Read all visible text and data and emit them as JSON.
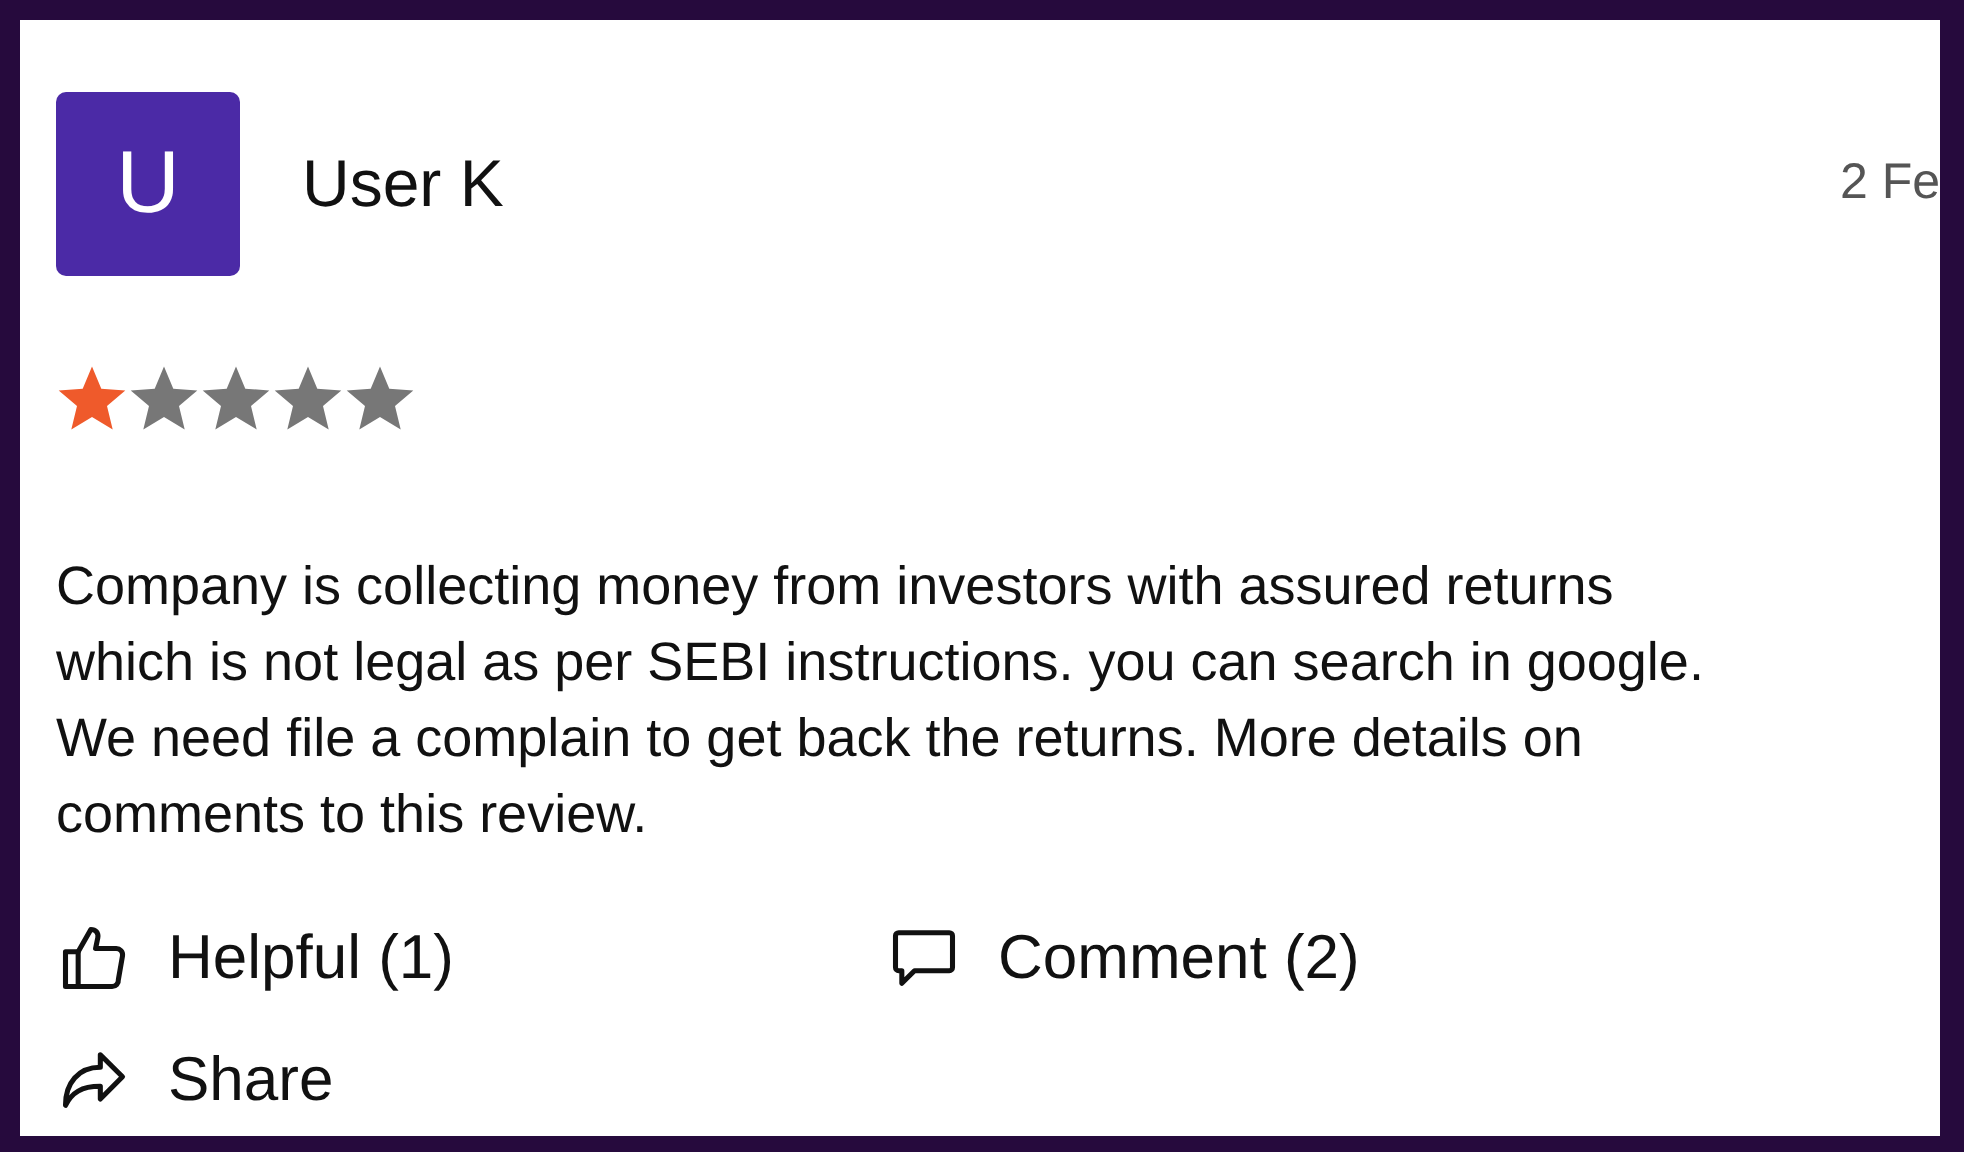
{
  "review": {
    "avatar_letter": "U",
    "author": "User K",
    "date": "2 Fe",
    "stars": 1,
    "text": "Company is collecting money from investors with assured returns which is not legal as per SEBI instructions. you can search in google. We need file a complain to get back the returns. More details on comments to this review.",
    "actions": [
      {
        "kind": "helpful",
        "label": "Helpful (1)"
      },
      {
        "kind": "comment",
        "label": "Comment (2)"
      },
      {
        "kind": "share",
        "label": "Share"
      }
    ]
  }
}
